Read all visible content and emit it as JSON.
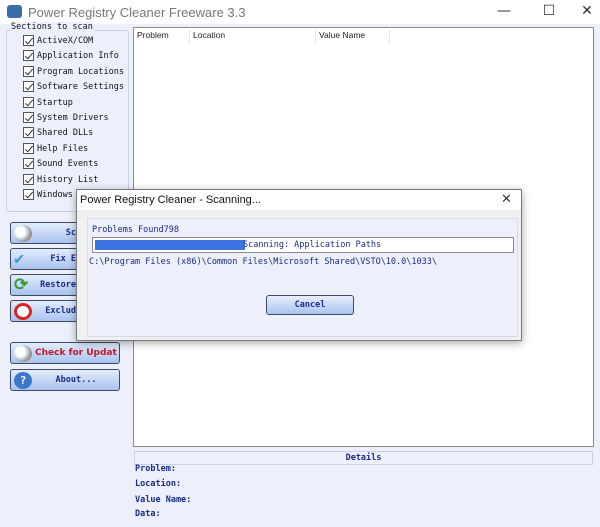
{
  "window": {
    "title": "Power Registry Cleaner Freeware 3.3",
    "minimize": "—",
    "maximize": "☐",
    "close": "✕"
  },
  "sections": {
    "label": "Sections to scan",
    "items": [
      {
        "label": "ActiveX/COM",
        "checked": true
      },
      {
        "label": "Application Info",
        "checked": true
      },
      {
        "label": "Program Locations",
        "checked": true
      },
      {
        "label": "Software Settings",
        "checked": true
      },
      {
        "label": "Startup",
        "checked": true
      },
      {
        "label": "System Drivers",
        "checked": true
      },
      {
        "label": "Shared DLLs",
        "checked": true
      },
      {
        "label": "Help Files",
        "checked": true
      },
      {
        "label": "Sound Events",
        "checked": true
      },
      {
        "label": "History List",
        "checked": true
      },
      {
        "label": "Windows Fonts",
        "checked": true
      }
    ]
  },
  "buttons": {
    "scan": "Scan",
    "fix": "Fix Errors",
    "restore": "Restore Backup",
    "exclude": "Exclude List",
    "update": "Check for Update",
    "about": "About..."
  },
  "list": {
    "columns": [
      "Problem",
      "Location",
      "Value Name"
    ]
  },
  "details": {
    "header": "Details",
    "problem": "Problem:",
    "location": "Location:",
    "value_name": "Value Name:",
    "data": "Data:"
  },
  "dialog": {
    "title": "Power Registry Cleaner - Scanning...",
    "close": "✕",
    "problems_found": "Problems Found798",
    "progress_percent": 36,
    "status": "Scanning: Application Paths",
    "path": "C:\\Program Files (x86)\\Common Files\\Microsoft Shared\\VSTO\\10.0\\1033\\",
    "cancel": "Cancel"
  },
  "colors": {
    "accent": "#3b73e0",
    "text": "#1a2b8a",
    "update": "#c0182a"
  }
}
